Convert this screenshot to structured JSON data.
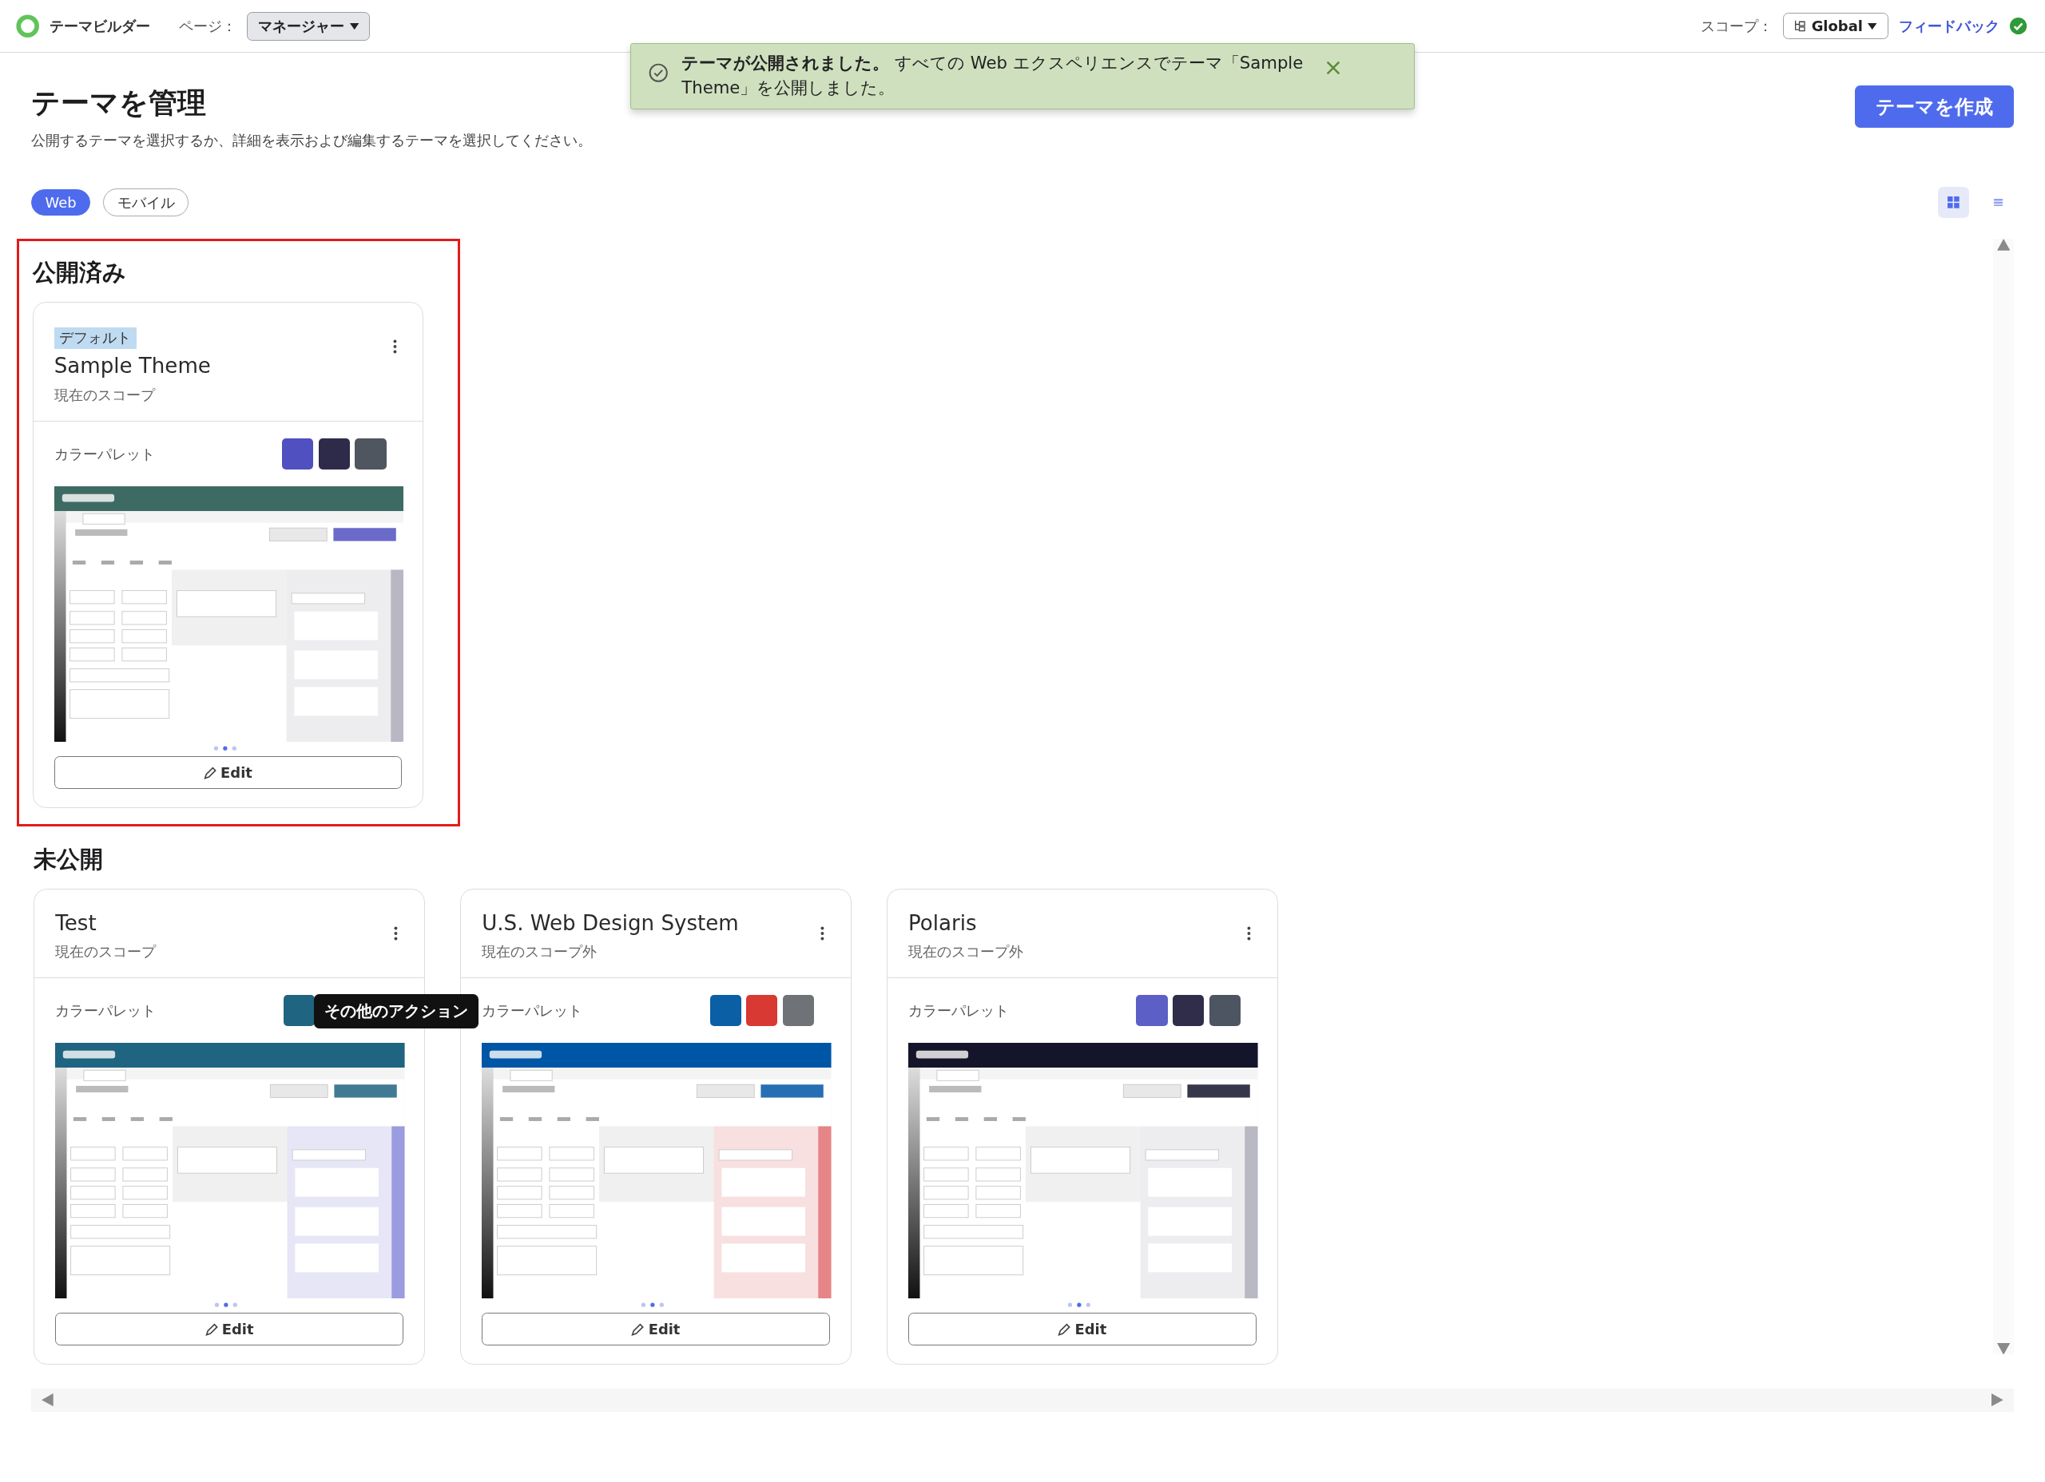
{
  "topbar": {
    "app_name": "テーマビルダー",
    "page_label": "ページ：",
    "page_value": "マネージャー",
    "scope_label": "スコープ：",
    "scope_value": "Global",
    "feedback": "フィードバック"
  },
  "toast": {
    "title": "テーマが公開されました。",
    "message": "すべての Web エクスペリエンスでテーマ「Sample Theme」を公開しました。"
  },
  "header": {
    "title": "テーマを管理",
    "subtitle": "公開するテーマを選択するか、詳細を表示および編集するテーマを選択してください。",
    "create_button": "テーマを作成"
  },
  "tabs": [
    {
      "label": "Web",
      "selected": true
    },
    {
      "label": "モバイル",
      "selected": false
    }
  ],
  "view_toggle": [
    {
      "kind": "grid",
      "selected": true
    },
    {
      "kind": "list",
      "selected": false
    }
  ],
  "sections": [
    {
      "title": "公開済み",
      "highlighted": true,
      "cards": [
        {
          "badge": "デフォルト",
          "name": "Sample Theme",
          "scope": "現在のスコープ",
          "palette_label": "カラーパレット",
          "swatches": [
            {
              "color": "#5050c0"
            },
            {
              "color": "#2e2b4a"
            },
            {
              "color": "#4f5660"
            }
          ],
          "preview_colors": [
            {
              "color": "#3d6b63"
            },
            {
              "color": "#b9b7c4"
            }
          ],
          "edit_label": "Edit"
        }
      ]
    },
    {
      "title": "未公開",
      "highlighted": false,
      "cards": [
        {
          "name": "Test",
          "scope": "現在のスコープ",
          "palette_label": "カラーパレット",
          "swatches": [
            {
              "color": "#1f6480"
            }
          ],
          "preview_colors": [
            {
              "color": "#1f6480"
            },
            {
              "color": "#9b9be0"
            }
          ],
          "edit_label": "Edit",
          "tooltip": "その他のアクション"
        },
        {
          "name": "U.S. Web Design System",
          "scope": "現在のスコープ外",
          "palette_label": "カラーパレット",
          "swatches": [
            {
              "color": "#0b5fa5"
            },
            {
              "color": "#d83933"
            },
            {
              "color": "#6f7378"
            }
          ],
          "preview_colors": [
            {
              "color": "#0056a6"
            },
            {
              "color": "#e58585"
            }
          ],
          "edit_label": "Edit"
        },
        {
          "name": "Polaris",
          "scope": "現在のスコープ外",
          "palette_label": "カラーパレット",
          "swatches": [
            {
              "color": "#5c5fc5"
            },
            {
              "color": "#2f2d4a"
            },
            {
              "color": "#4e5562"
            }
          ],
          "preview_colors": [
            {
              "color": "#14142b"
            },
            {
              "color": "#b9b9c4"
            }
          ],
          "edit_label": "Edit"
        }
      ]
    }
  ]
}
